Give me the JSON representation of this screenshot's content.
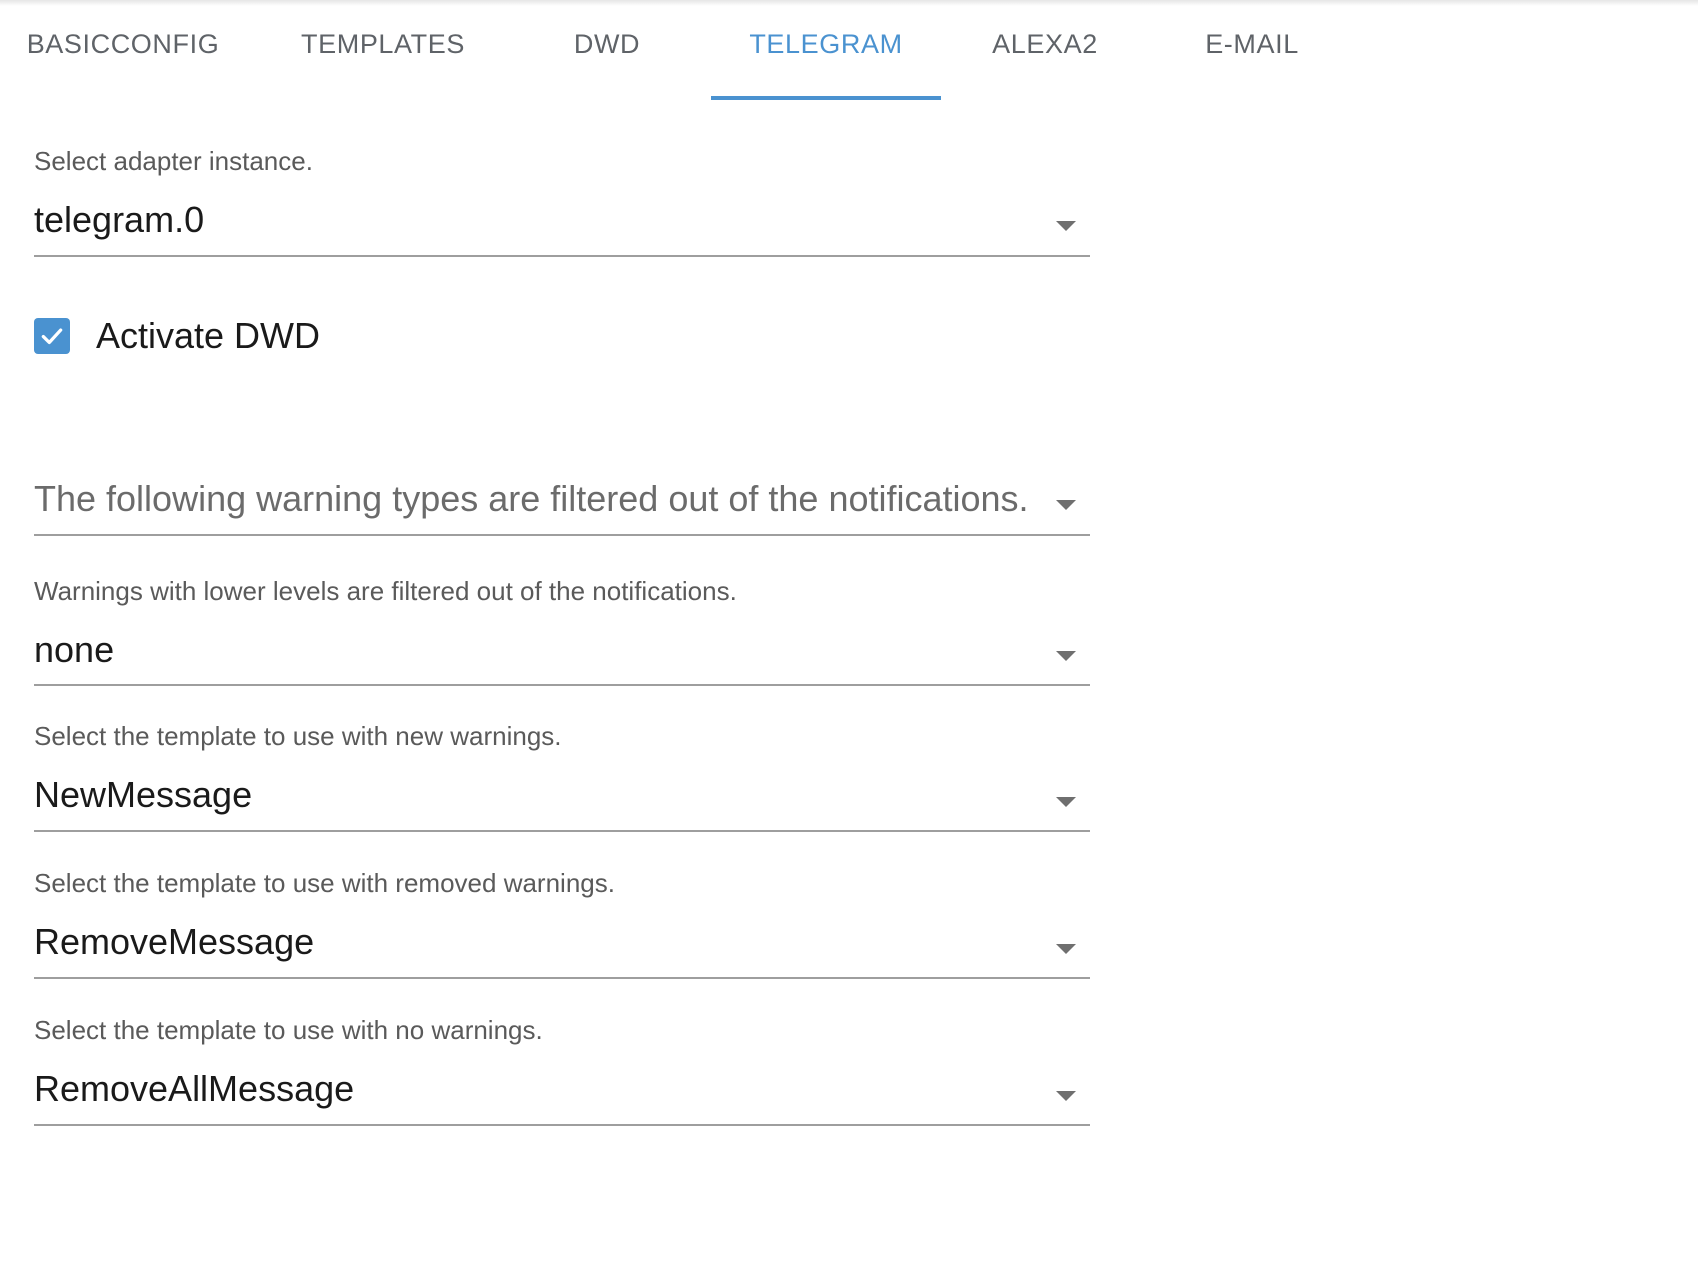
{
  "tabs": [
    {
      "label": "BASICCONFIG",
      "active": false
    },
    {
      "label": "TEMPLATES",
      "active": false
    },
    {
      "label": "DWD",
      "active": false
    },
    {
      "label": "TELEGRAM",
      "active": true
    },
    {
      "label": "ALEXA2",
      "active": false
    },
    {
      "label": "E-MAIL",
      "active": false
    }
  ],
  "adapter": {
    "label": "Select adapter instance.",
    "value": "telegram.0"
  },
  "activate_dwd": {
    "label": "Activate DWD",
    "checked": true
  },
  "filter_types": {
    "placeholder": "The following warning types are filtered out of the notifications."
  },
  "level": {
    "label": "Warnings with lower levels are filtered out of the notifications.",
    "value": "none"
  },
  "new_template": {
    "label": "Select the template to use with new warnings.",
    "value": "NewMessage"
  },
  "removed_template": {
    "label": "Select the template to use with removed warnings.",
    "value": "RemoveMessage"
  },
  "none_template": {
    "label": "Select the template to use with no warnings.",
    "value": "RemoveAllMessage"
  },
  "colors": {
    "accent": "#4a92d0",
    "tab_text": "#5f6368",
    "underline": "#9e9e9e"
  },
  "icons": {
    "dropdown": "chevron-down-icon",
    "check": "checkmark-icon"
  }
}
